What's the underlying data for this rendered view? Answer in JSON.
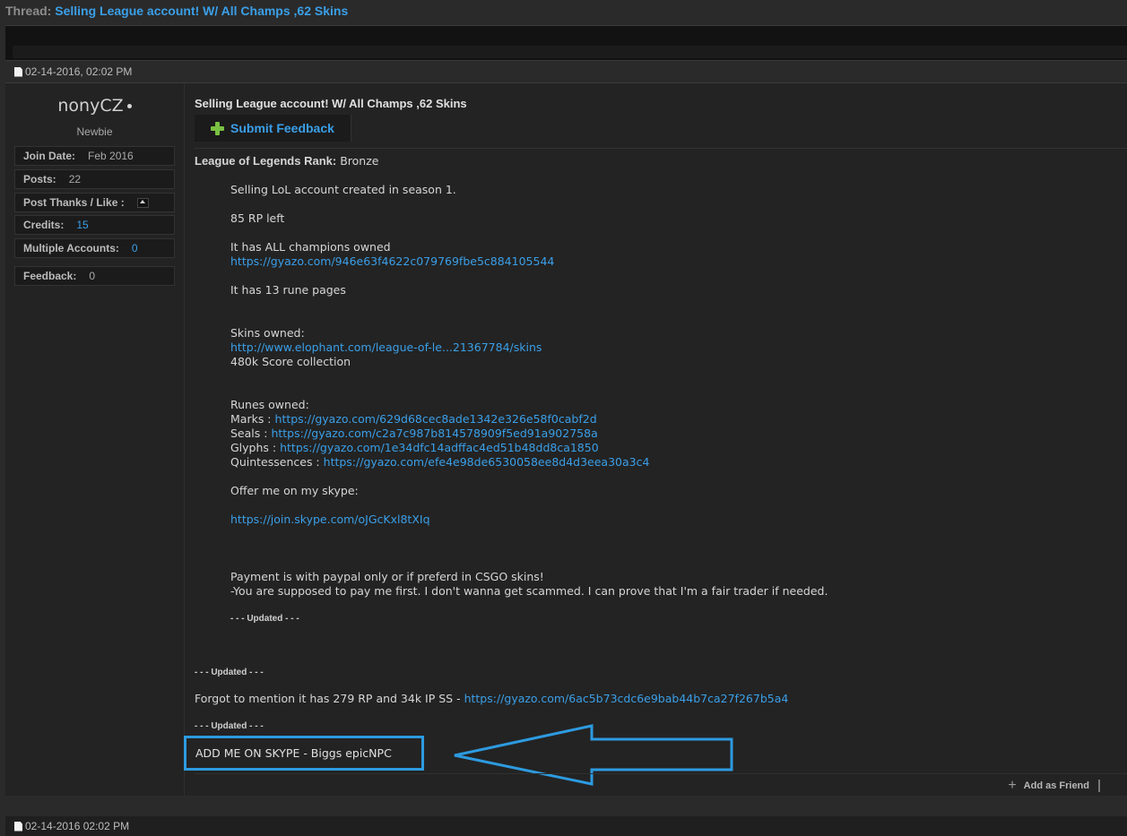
{
  "thread": {
    "label": "Thread:",
    "title": "Selling League account! W/ All Champs ,62 Skins"
  },
  "post_top": {
    "date": "02-14-2016, 02:02 PM"
  },
  "user": {
    "name": "nonyCZ",
    "title": "Newbie",
    "stats": [
      {
        "key": "Join Date:",
        "value": "Feb 2016"
      },
      {
        "key": "Posts:",
        "value": "22"
      },
      {
        "key": "Post Thanks / Like :",
        "value": ""
      },
      {
        "key": "Credits:",
        "value": "15"
      },
      {
        "key": "Multiple Accounts:",
        "value": "0"
      },
      {
        "key": "Feedback:",
        "value": "0"
      }
    ]
  },
  "post": {
    "heading": "Selling League account! W/ All Champs ,62 Skins",
    "feedback_button": "Submit Feedback",
    "rank_label": "League of Legends Rank:",
    "rank_value": "Bronze",
    "lines": {
      "l1": "Selling LoL account created in season 1.",
      "l2": "85 RP left",
      "l3": "It has ALL champions owned",
      "l3_link": "https://gyazo.com/946e63f4622c079769fbe5c884105544",
      "l4": "It has 13 rune pages",
      "l5": "Skins owned:",
      "l5_link": "http://www.elophant.com/league-of-le...21367784/skins",
      "l6": "480k Score collection",
      "l7": "Runes owned:",
      "marks_label": "Marks :",
      "marks_link": "https://gyazo.com/629d68cec8ade1342e326e58f0cabf2d",
      "seals_label": "Seals :",
      "seals_link": "https://gyazo.com/c2a7c987b814578909f5ed91a902758a",
      "glyphs_label": "Glyphs :",
      "glyphs_link": "https://gyazo.com/1e34dfc14adffac4ed51b48dd8ca1850",
      "quint_label": "Quintessences :",
      "quint_link": "https://gyazo.com/efe4e98de6530058ee8d4d3eea30a3c4",
      "l8": "Offer me on my skype:",
      "skype_link": "https://join.skype.com/oJGcKxl8tXIq",
      "l9": "Payment is with paypal only or if preferd in CSGO skins!",
      "l10": "-You are supposed to pay me first. I don't wanna get scammed. I can prove that I'm a fair trader if needed.",
      "updated1": "- - - Updated - - -",
      "updated2": "- - - Updated - - -",
      "forgot": "Forgot to mention it has 279 RP and 34k IP SS - ",
      "forgot_link": "https://gyazo.com/6ac5b73cdc6e9bab44b7ca27f267b5a4",
      "updated3": "- - - Updated - - -"
    },
    "skype_callout": "ADD ME ON SKYPE - Biggs epicNPC",
    "add_friend": "Add as Friend"
  },
  "post_bottom": {
    "date": "02-14-2016 02:02 PM"
  },
  "colors": {
    "link": "#3a9fe8",
    "callout": "#2d9be0",
    "plus": "#7ac142"
  }
}
